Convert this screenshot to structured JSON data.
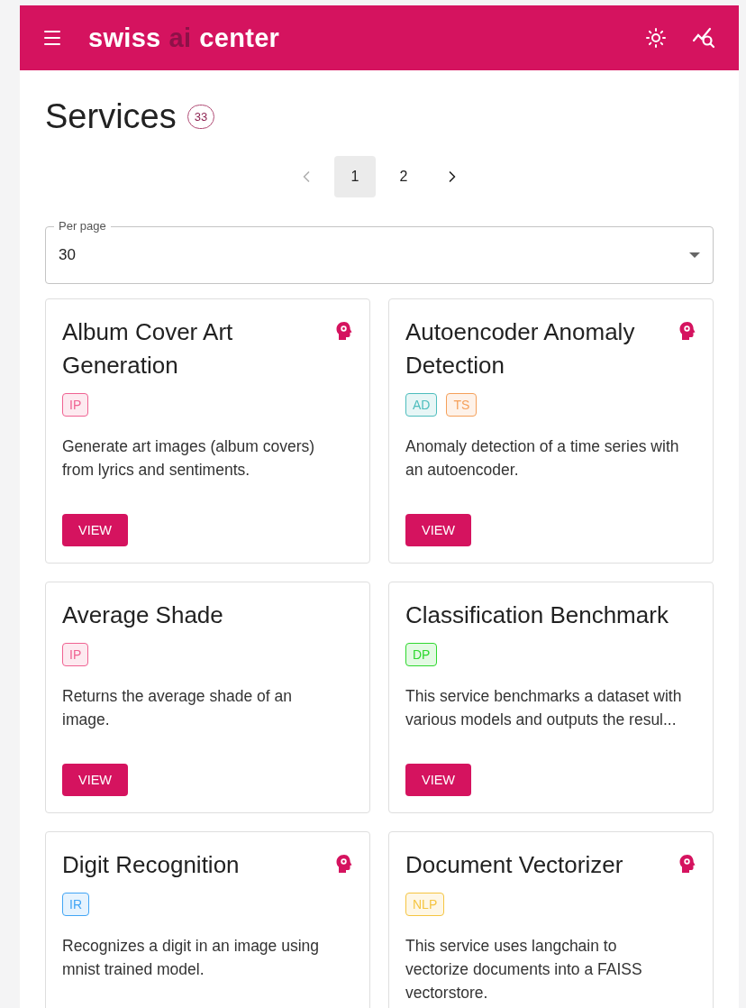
{
  "header": {
    "logo": {
      "before": "swiss",
      "highlight": "ai",
      "after": "center"
    }
  },
  "page": {
    "title": "Services",
    "count": "33"
  },
  "pagination": {
    "prev": {
      "disabled": true
    },
    "pages": [
      {
        "label": "1",
        "selected": true
      },
      {
        "label": "2",
        "selected": false
      }
    ],
    "next": {
      "disabled": false
    }
  },
  "per_page": {
    "label": "Per page",
    "value": "30"
  },
  "services": [
    {
      "title": "Album Cover Art Generation",
      "ai_icon": true,
      "tags": [
        {
          "label": "IP",
          "color": "#f06292"
        }
      ],
      "description": "Generate art images (album covers) from lyrics and sentiments.",
      "button": "VIEW"
    },
    {
      "title": "Autoencoder Anomaly Detection",
      "ai_icon": true,
      "tags": [
        {
          "label": "AD",
          "color": "#4dbdbd"
        },
        {
          "label": "TS",
          "color": "#f5a05a"
        }
      ],
      "description": "Anomaly detection of a time series with an autoencoder.",
      "button": "VIEW"
    },
    {
      "title": "Average Shade",
      "ai_icon": false,
      "tags": [
        {
          "label": "IP",
          "color": "#f06292"
        }
      ],
      "description": "Returns the average shade of an image.",
      "button": "VIEW"
    },
    {
      "title": "Classification Benchmark",
      "ai_icon": false,
      "tags": [
        {
          "label": "DP",
          "color": "#2ed82e"
        }
      ],
      "description": "This service benchmarks a dataset with various models and outputs the resul...",
      "button": "VIEW"
    },
    {
      "title": "Digit Recognition",
      "ai_icon": true,
      "tags": [
        {
          "label": "IR",
          "color": "#42a5f5"
        }
      ],
      "description": "Recognizes a digit in an image using mnist trained model."
    },
    {
      "title": "Document Vectorizer",
      "ai_icon": true,
      "tags": [
        {
          "label": "NLP",
          "color": "#f5c542"
        }
      ],
      "description": "This service uses langchain to vectorize documents into a FAISS vectorstore."
    }
  ]
}
